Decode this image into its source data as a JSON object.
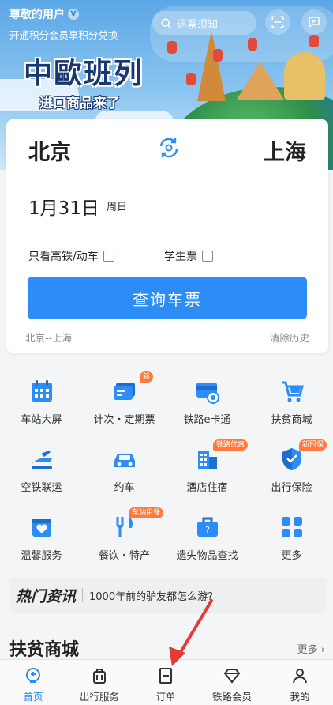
{
  "header": {
    "greeting": "尊敬的用户",
    "member_text": "开通积分会员享积分兑换",
    "search_placeholder": "退票须知",
    "scan_icon": "scan-icon",
    "message_icon": "message-icon"
  },
  "banner": {
    "title": "中歐班列",
    "subtitle": "进口商品来了"
  },
  "booking": {
    "from": "北京",
    "to": "上海",
    "date": "1月31日",
    "weekday": "周日",
    "option_gaotie": "只看高铁/动车",
    "option_student": "学生票",
    "query_button": "查询车票",
    "history_route": "北京--上海",
    "clear_history": "清除历史"
  },
  "services": [
    {
      "label": "车站大屏",
      "icon": "calendar-icon",
      "tag": ""
    },
    {
      "label": "计次・定期票",
      "icon": "ticket-card-icon",
      "tag": "新"
    },
    {
      "label": "铁路e卡通",
      "icon": "ecard-icon",
      "tag": ""
    },
    {
      "label": "扶贫商城",
      "icon": "cart-icon",
      "tag": ""
    },
    {
      "label": "空铁联运",
      "icon": "train-plane-icon",
      "tag": ""
    },
    {
      "label": "约车",
      "icon": "car-icon",
      "tag": ""
    },
    {
      "label": "酒店住宿",
      "icon": "hotel-icon",
      "tag": "铁路优惠"
    },
    {
      "label": "出行保险",
      "icon": "shield-icon",
      "tag": "新冠保"
    },
    {
      "label": "温馨服务",
      "icon": "heart-bag-icon",
      "tag": ""
    },
    {
      "label": "餐饮・特产",
      "icon": "fork-icon",
      "tag": "车站用餐"
    },
    {
      "label": "遗失物品查找",
      "icon": "suitcase-icon",
      "tag": ""
    },
    {
      "label": "更多",
      "icon": "grid-icon",
      "tag": ""
    }
  ],
  "news": {
    "heading": "热门资讯",
    "text": "1000年前的驴友都怎么游?"
  },
  "section": {
    "title": "扶贫商城",
    "more": "更多"
  },
  "tabs": [
    {
      "label": "首页",
      "icon": "home-icon",
      "active": true
    },
    {
      "label": "出行服务",
      "icon": "luggage-icon",
      "active": false
    },
    {
      "label": "订单",
      "icon": "order-icon",
      "active": false
    },
    {
      "label": "铁路会员",
      "icon": "diamond-icon",
      "active": false
    },
    {
      "label": "我的",
      "icon": "person-icon",
      "active": false
    }
  ],
  "colors": {
    "accent": "#2b8df5",
    "tag": "#ff7a3c",
    "icon_blue": "#2b8df5",
    "arrow": "#e53935"
  }
}
